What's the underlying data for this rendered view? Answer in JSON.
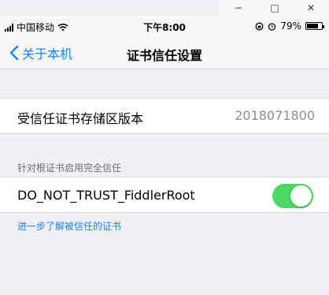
{
  "window": {
    "minimize_label": "−",
    "maximize_label": "□",
    "close_label": "✕"
  },
  "statusbar": {
    "carrier": "中国移动",
    "time": "下午8:00",
    "battery": "79%",
    "battery_level": 0.79
  },
  "navbar": {
    "back_label": "关于本机",
    "title": "证书信任设置"
  },
  "store_version": {
    "label": "受信任证书存储区版本",
    "value": "2018071800"
  },
  "trust_section": {
    "header": "针对根证书启用完全信任",
    "certificate_name": "DO_NOT_TRUST_FiddlerRoot",
    "enabled": true
  },
  "learn_more": "进一步了解被信任的证书",
  "colors": {
    "accent": "#1a82fb",
    "toggle_on": "#4cd964",
    "background": "#efeff4"
  }
}
